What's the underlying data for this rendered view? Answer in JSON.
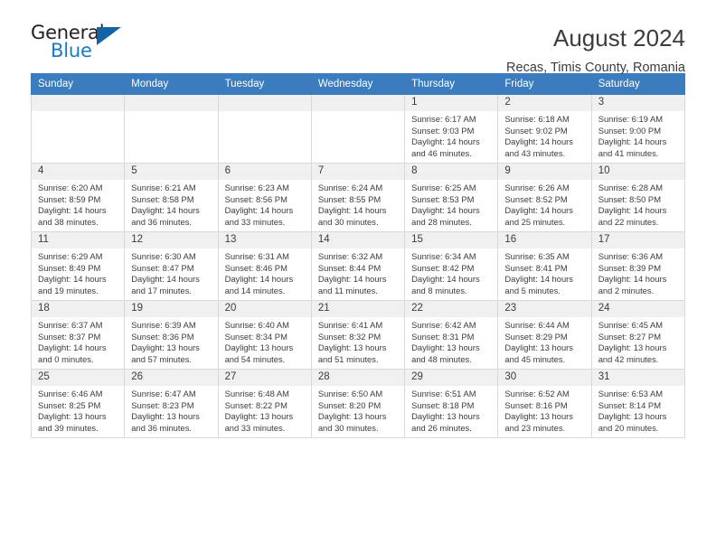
{
  "brand": {
    "name_part1": "General",
    "name_part2": "Blue",
    "triangle_color": "#1464a5",
    "blue_color": "#1a7bc4"
  },
  "header": {
    "title": "August 2024",
    "subtitle": "Recas, Timis County, Romania"
  },
  "theme": {
    "header_row_bg": "#3a7cbe",
    "daynum_bg": "#f0f0f0",
    "grid_border": "#d9d9d9",
    "text": "#3c3c3c"
  },
  "weekday_headers": [
    "Sunday",
    "Monday",
    "Tuesday",
    "Wednesday",
    "Thursday",
    "Friday",
    "Saturday"
  ],
  "labels": {
    "sunrise_prefix": "Sunrise: ",
    "sunset_prefix": "Sunset: ",
    "daylight_prefix": "Daylight: "
  },
  "weeks": [
    [
      {
        "empty": true
      },
      {
        "empty": true
      },
      {
        "empty": true
      },
      {
        "empty": true
      },
      {
        "day": "1",
        "sunrise": "Sunrise: 6:17 AM",
        "sunset": "Sunset: 9:03 PM",
        "daylight_line1": "Daylight: 14 hours",
        "daylight_line2": "and 46 minutes."
      },
      {
        "day": "2",
        "sunrise": "Sunrise: 6:18 AM",
        "sunset": "Sunset: 9:02 PM",
        "daylight_line1": "Daylight: 14 hours",
        "daylight_line2": "and 43 minutes."
      },
      {
        "day": "3",
        "sunrise": "Sunrise: 6:19 AM",
        "sunset": "Sunset: 9:00 PM",
        "daylight_line1": "Daylight: 14 hours",
        "daylight_line2": "and 41 minutes."
      }
    ],
    [
      {
        "day": "4",
        "sunrise": "Sunrise: 6:20 AM",
        "sunset": "Sunset: 8:59 PM",
        "daylight_line1": "Daylight: 14 hours",
        "daylight_line2": "and 38 minutes."
      },
      {
        "day": "5",
        "sunrise": "Sunrise: 6:21 AM",
        "sunset": "Sunset: 8:58 PM",
        "daylight_line1": "Daylight: 14 hours",
        "daylight_line2": "and 36 minutes."
      },
      {
        "day": "6",
        "sunrise": "Sunrise: 6:23 AM",
        "sunset": "Sunset: 8:56 PM",
        "daylight_line1": "Daylight: 14 hours",
        "daylight_line2": "and 33 minutes."
      },
      {
        "day": "7",
        "sunrise": "Sunrise: 6:24 AM",
        "sunset": "Sunset: 8:55 PM",
        "daylight_line1": "Daylight: 14 hours",
        "daylight_line2": "and 30 minutes."
      },
      {
        "day": "8",
        "sunrise": "Sunrise: 6:25 AM",
        "sunset": "Sunset: 8:53 PM",
        "daylight_line1": "Daylight: 14 hours",
        "daylight_line2": "and 28 minutes."
      },
      {
        "day": "9",
        "sunrise": "Sunrise: 6:26 AM",
        "sunset": "Sunset: 8:52 PM",
        "daylight_line1": "Daylight: 14 hours",
        "daylight_line2": "and 25 minutes."
      },
      {
        "day": "10",
        "sunrise": "Sunrise: 6:28 AM",
        "sunset": "Sunset: 8:50 PM",
        "daylight_line1": "Daylight: 14 hours",
        "daylight_line2": "and 22 minutes."
      }
    ],
    [
      {
        "day": "11",
        "sunrise": "Sunrise: 6:29 AM",
        "sunset": "Sunset: 8:49 PM",
        "daylight_line1": "Daylight: 14 hours",
        "daylight_line2": "and 19 minutes."
      },
      {
        "day": "12",
        "sunrise": "Sunrise: 6:30 AM",
        "sunset": "Sunset: 8:47 PM",
        "daylight_line1": "Daylight: 14 hours",
        "daylight_line2": "and 17 minutes."
      },
      {
        "day": "13",
        "sunrise": "Sunrise: 6:31 AM",
        "sunset": "Sunset: 8:46 PM",
        "daylight_line1": "Daylight: 14 hours",
        "daylight_line2": "and 14 minutes."
      },
      {
        "day": "14",
        "sunrise": "Sunrise: 6:32 AM",
        "sunset": "Sunset: 8:44 PM",
        "daylight_line1": "Daylight: 14 hours",
        "daylight_line2": "and 11 minutes."
      },
      {
        "day": "15",
        "sunrise": "Sunrise: 6:34 AM",
        "sunset": "Sunset: 8:42 PM",
        "daylight_line1": "Daylight: 14 hours",
        "daylight_line2": "and 8 minutes."
      },
      {
        "day": "16",
        "sunrise": "Sunrise: 6:35 AM",
        "sunset": "Sunset: 8:41 PM",
        "daylight_line1": "Daylight: 14 hours",
        "daylight_line2": "and 5 minutes."
      },
      {
        "day": "17",
        "sunrise": "Sunrise: 6:36 AM",
        "sunset": "Sunset: 8:39 PM",
        "daylight_line1": "Daylight: 14 hours",
        "daylight_line2": "and 2 minutes."
      }
    ],
    [
      {
        "day": "18",
        "sunrise": "Sunrise: 6:37 AM",
        "sunset": "Sunset: 8:37 PM",
        "daylight_line1": "Daylight: 14 hours",
        "daylight_line2": "and 0 minutes."
      },
      {
        "day": "19",
        "sunrise": "Sunrise: 6:39 AM",
        "sunset": "Sunset: 8:36 PM",
        "daylight_line1": "Daylight: 13 hours",
        "daylight_line2": "and 57 minutes."
      },
      {
        "day": "20",
        "sunrise": "Sunrise: 6:40 AM",
        "sunset": "Sunset: 8:34 PM",
        "daylight_line1": "Daylight: 13 hours",
        "daylight_line2": "and 54 minutes."
      },
      {
        "day": "21",
        "sunrise": "Sunrise: 6:41 AM",
        "sunset": "Sunset: 8:32 PM",
        "daylight_line1": "Daylight: 13 hours",
        "daylight_line2": "and 51 minutes."
      },
      {
        "day": "22",
        "sunrise": "Sunrise: 6:42 AM",
        "sunset": "Sunset: 8:31 PM",
        "daylight_line1": "Daylight: 13 hours",
        "daylight_line2": "and 48 minutes."
      },
      {
        "day": "23",
        "sunrise": "Sunrise: 6:44 AM",
        "sunset": "Sunset: 8:29 PM",
        "daylight_line1": "Daylight: 13 hours",
        "daylight_line2": "and 45 minutes."
      },
      {
        "day": "24",
        "sunrise": "Sunrise: 6:45 AM",
        "sunset": "Sunset: 8:27 PM",
        "daylight_line1": "Daylight: 13 hours",
        "daylight_line2": "and 42 minutes."
      }
    ],
    [
      {
        "day": "25",
        "sunrise": "Sunrise: 6:46 AM",
        "sunset": "Sunset: 8:25 PM",
        "daylight_line1": "Daylight: 13 hours",
        "daylight_line2": "and 39 minutes."
      },
      {
        "day": "26",
        "sunrise": "Sunrise: 6:47 AM",
        "sunset": "Sunset: 8:23 PM",
        "daylight_line1": "Daylight: 13 hours",
        "daylight_line2": "and 36 minutes."
      },
      {
        "day": "27",
        "sunrise": "Sunrise: 6:48 AM",
        "sunset": "Sunset: 8:22 PM",
        "daylight_line1": "Daylight: 13 hours",
        "daylight_line2": "and 33 minutes."
      },
      {
        "day": "28",
        "sunrise": "Sunrise: 6:50 AM",
        "sunset": "Sunset: 8:20 PM",
        "daylight_line1": "Daylight: 13 hours",
        "daylight_line2": "and 30 minutes."
      },
      {
        "day": "29",
        "sunrise": "Sunrise: 6:51 AM",
        "sunset": "Sunset: 8:18 PM",
        "daylight_line1": "Daylight: 13 hours",
        "daylight_line2": "and 26 minutes."
      },
      {
        "day": "30",
        "sunrise": "Sunrise: 6:52 AM",
        "sunset": "Sunset: 8:16 PM",
        "daylight_line1": "Daylight: 13 hours",
        "daylight_line2": "and 23 minutes."
      },
      {
        "day": "31",
        "sunrise": "Sunrise: 6:53 AM",
        "sunset": "Sunset: 8:14 PM",
        "daylight_line1": "Daylight: 13 hours",
        "daylight_line2": "and 20 minutes."
      }
    ]
  ]
}
